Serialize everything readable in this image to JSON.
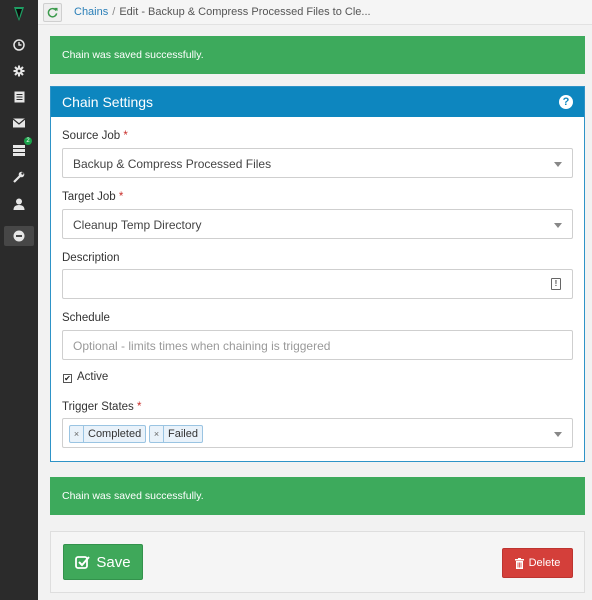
{
  "sidebar": {
    "logo_icon": "pen-nib-logo-icon",
    "items": [
      {
        "icon": "clock-icon"
      },
      {
        "icon": "gear-icon"
      },
      {
        "icon": "document-icon"
      },
      {
        "icon": "envelope-icon"
      },
      {
        "icon": "list-icon",
        "badge": "2"
      },
      {
        "icon": "wrench-icon"
      },
      {
        "icon": "user-icon"
      },
      {
        "icon": "minus-circle-icon",
        "active": true
      }
    ]
  },
  "topbar": {
    "refresh_icon": "refresh-icon",
    "breadcrumb_link": "Chains",
    "breadcrumb_sep": "/",
    "breadcrumb_current": "Edit - Backup & Compress Processed Files to Cle..."
  },
  "alerts": {
    "top": "Chain was saved successfully.",
    "bottom": "Chain was saved successfully."
  },
  "panel": {
    "title": "Chain Settings",
    "help_icon": "?",
    "source_job": {
      "label": "Source Job",
      "required": "*",
      "value": "Backup & Compress Processed Files"
    },
    "target_job": {
      "label": "Target Job",
      "required": "*",
      "value": "Cleanup Temp Directory"
    },
    "description": {
      "label": "Description",
      "value": ""
    },
    "schedule": {
      "label": "Schedule",
      "placeholder": "Optional - limits times when chaining is triggered"
    },
    "active": {
      "label": "Active",
      "checked": true,
      "mark": "✔"
    },
    "trigger_states": {
      "label": "Trigger States",
      "required": "*",
      "tags": [
        "Completed",
        "Failed"
      ],
      "remove_glyph": "×"
    }
  },
  "footer": {
    "save_label": "Save",
    "delete_label": "Delete"
  },
  "colors": {
    "success": "#3daa5c",
    "primary": "#0d86bf",
    "danger": "#d43f3a",
    "sidebar": "#2b2b2b"
  }
}
